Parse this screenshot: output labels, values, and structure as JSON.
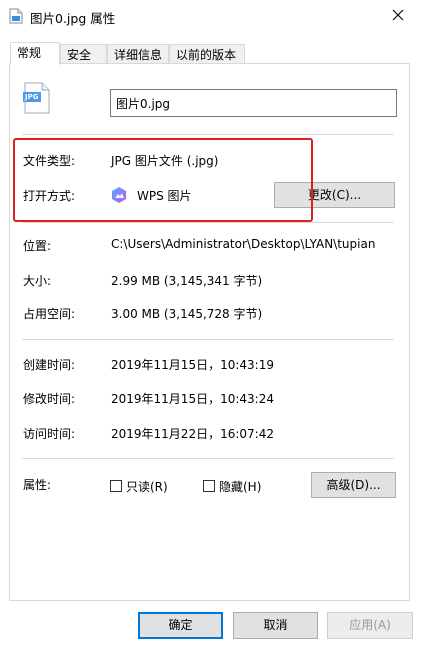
{
  "window": {
    "title": "图片0.jpg 属性",
    "close_icon": "close-icon"
  },
  "tabs": [
    {
      "label": "常规",
      "active": true
    },
    {
      "label": "安全"
    },
    {
      "label": "详细信息"
    },
    {
      "label": "以前的版本"
    }
  ],
  "file": {
    "name": "图片0.jpg",
    "icon_text": "JPG"
  },
  "type": {
    "label": "文件类型:",
    "value": "JPG 图片文件 (.jpg)"
  },
  "open_with": {
    "label": "打开方式:",
    "value": "WPS 图片",
    "change_button": "更改(C)..."
  },
  "location": {
    "label": "位置:",
    "value": "C:\\Users\\Administrator\\Desktop\\LYAN\\tupian"
  },
  "size": {
    "label": "大小:",
    "value": "2.99 MB (3,145,341 字节)"
  },
  "disk_size": {
    "label": "占用空间:",
    "value": "3.00 MB (3,145,728 字节)"
  },
  "created": {
    "label": "创建时间:",
    "value": "2019年11月15日，10:43:19"
  },
  "modified": {
    "label": "修改时间:",
    "value": "2019年11月15日，10:43:24"
  },
  "accessed": {
    "label": "访问时间:",
    "value": "2019年11月22日，16:07:42"
  },
  "attributes": {
    "label": "属性:",
    "readonly_label": "只读(R)",
    "hidden_label": "隐藏(H)",
    "advanced_button": "高级(D)..."
  },
  "footer": {
    "ok": "确定",
    "cancel": "取消",
    "apply": "应用(A)"
  },
  "colors": {
    "highlight": "#e02020",
    "accent": "#0078d7"
  }
}
